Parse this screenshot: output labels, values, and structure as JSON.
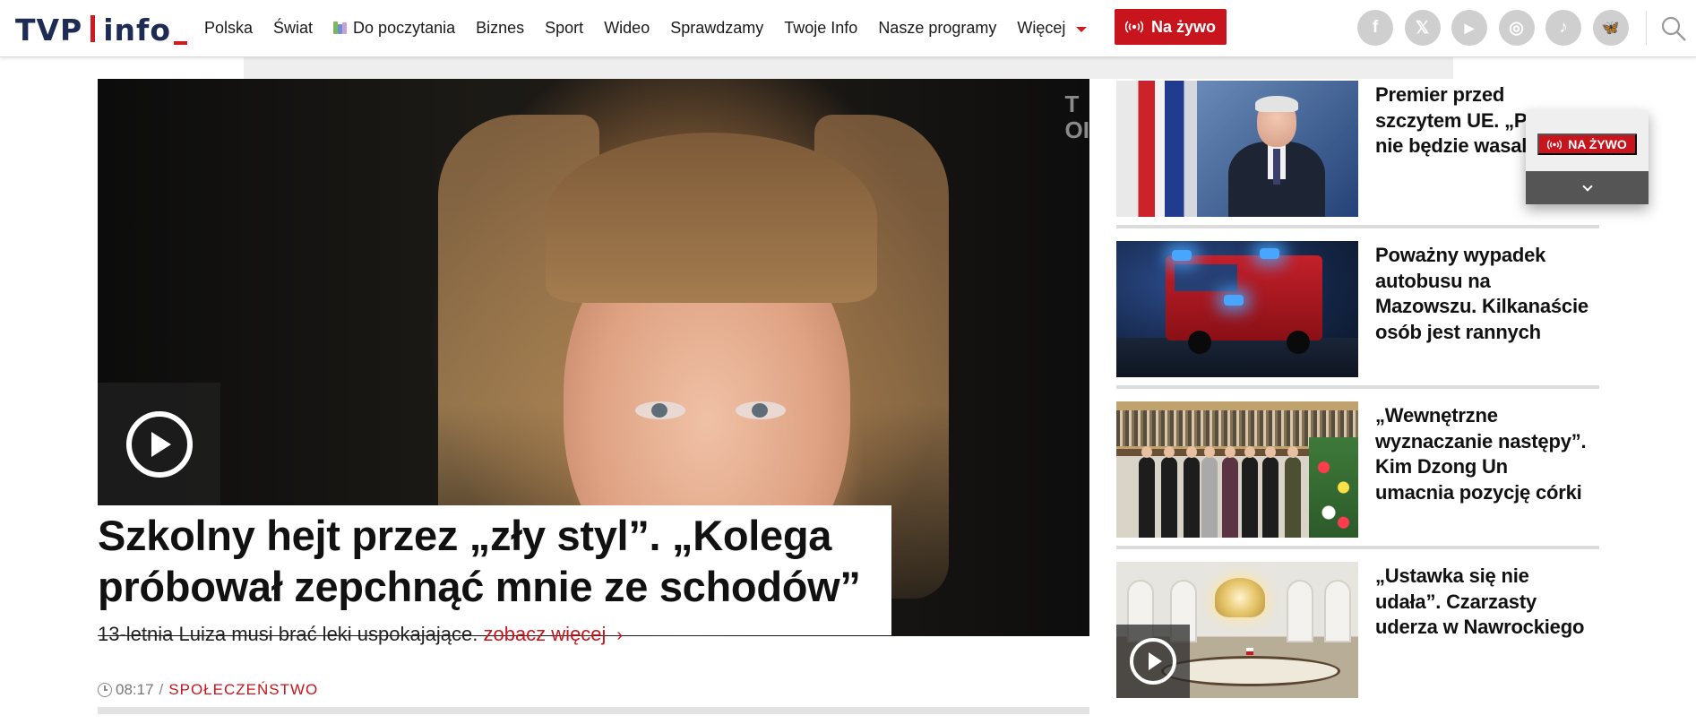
{
  "logo": {
    "part1": "TVP",
    "part2": "info"
  },
  "nav": {
    "items": [
      {
        "label": "Polska"
      },
      {
        "label": "Świat"
      },
      {
        "label": "Do poczytania",
        "icon": "books-icon"
      },
      {
        "label": "Biznes"
      },
      {
        "label": "Sport"
      },
      {
        "label": "Wideo"
      },
      {
        "label": "Sprawdzamy"
      },
      {
        "label": "Twoje Info"
      },
      {
        "label": "Nasze programy"
      }
    ],
    "more_label": "Więcej"
  },
  "live_button": {
    "label": "Na żywo"
  },
  "social": [
    {
      "name": "facebook-icon",
      "glyph": "f"
    },
    {
      "name": "x-icon",
      "glyph": "𝕏"
    },
    {
      "name": "youtube-icon",
      "glyph": "▶"
    },
    {
      "name": "instagram-icon",
      "glyph": "◎"
    },
    {
      "name": "tiktok-icon",
      "glyph": "♪"
    },
    {
      "name": "bluesky-icon",
      "glyph": "🦋"
    }
  ],
  "hero": {
    "title": "Szkolny hejt przez „zły styl”. „Kolega próbował zepchnąć mnie ze schodów”",
    "lead": "13-letnia Luiza musi brać leki uspokajające.",
    "more_label": "zobacz więcej",
    "more_chevron": "›",
    "time": "08:17",
    "separator": "/",
    "category": "SPOŁECZEŃSTWO",
    "watermark": "T\nOI"
  },
  "sidebar": {
    "items": [
      {
        "title": "Premier przed szczytem UE. „Polska nie będzie wasalem”"
      },
      {
        "title": "Poważny wypadek autobusu na Mazowszu. Kilkanaście osób jest rannych"
      },
      {
        "title": "„Wewnętrzne wyznaczanie następy”. Kim Dzong Un umacnia pozycję córki"
      },
      {
        "title": "„Ustawka się nie udała”. Czarzasty uderza w Nawrockiego",
        "video": true
      }
    ]
  },
  "live_widget": {
    "label": "NA ŻYWO"
  },
  "colors": {
    "accent": "#c8151d",
    "navy": "#1d2b55",
    "social_bg": "#cfcfcf"
  }
}
